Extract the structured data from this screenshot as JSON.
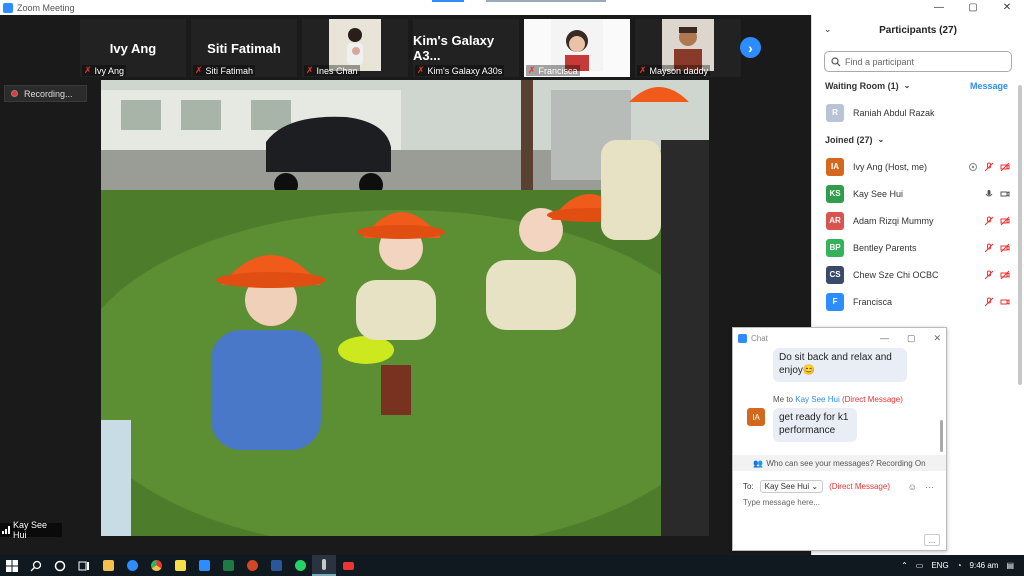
{
  "window": {
    "title": "Zoom Meeting",
    "controls": [
      "—",
      "▢",
      "✕"
    ]
  },
  "gallery": {
    "tiles": [
      {
        "big_name": "Ivy Ang",
        "label": "Ivy Ang",
        "has_video": false
      },
      {
        "big_name": "Siti Fatimah",
        "label": "Siti Fatimah",
        "has_video": false
      },
      {
        "big_name": "",
        "label": "Ines Chan",
        "has_video": true
      },
      {
        "big_name": "Kim's Galaxy A3...",
        "label": "Kim's Galaxy A30s",
        "has_video": false
      },
      {
        "big_name": "",
        "label": "Francisca",
        "has_video": true
      },
      {
        "big_name": "",
        "label": "Mayson daddy",
        "has_video": true
      }
    ],
    "next_icon": "chevron-right-icon"
  },
  "recording": {
    "label": "Recording..."
  },
  "active_speaker": {
    "name": "Kay See Hui"
  },
  "participants": {
    "title": "Participants (27)",
    "search_placeholder": "Find a participant",
    "waiting_room": {
      "label": "Waiting Room (1)",
      "message_button": "Message",
      "people": [
        {
          "initial": "R",
          "name": "Raniah Abdul Razak",
          "color": "#b8c4d6"
        }
      ]
    },
    "joined": {
      "label": "Joined (27)",
      "people": [
        {
          "initials": "IA",
          "name": "Ivy Ang (Host, me)",
          "color": "#d2691e",
          "mic": "muted",
          "video": "off",
          "extra": "share-icon"
        },
        {
          "initials": "KS",
          "name": "Kay See Hui",
          "color": "#2e9e4a",
          "mic": "on",
          "video": "on"
        },
        {
          "initials": "AR",
          "name": "Adam Rizqi Mummy",
          "color": "#d9534f",
          "mic": "muted",
          "video": "off"
        },
        {
          "initials": "BP",
          "name": "Bentley Parents",
          "color": "#34b35a",
          "mic": "muted",
          "video": "off"
        },
        {
          "initials": "CS",
          "name": "Chew Sze Chi OCBC",
          "color": "#3a4a6b",
          "mic": "muted",
          "video": "off"
        },
        {
          "initials": "F",
          "name": "Francisca",
          "color": "#2d8cff",
          "mic": "muted",
          "video": "on"
        }
      ]
    }
  },
  "chat": {
    "title": "Chat",
    "messages": [
      {
        "text": "Do sit back and relax and enjoy😊"
      },
      {
        "meta_from": "Me to",
        "meta_to": "Kay See Hui",
        "meta_dm": "(Direct Message)",
        "avatar": "IA",
        "text": "get ready for k1 performance"
      }
    ],
    "who_can_see": "Who can see your messages? Recording On",
    "to_label": "To:",
    "to_recipient": "Kay See Hui",
    "to_dm": "(Direct Message)",
    "input_placeholder": "Type message here...",
    "more_label": "..."
  },
  "taskbar": {
    "language": "ENG",
    "time": "9:46 am",
    "apps": [
      "windows-icon",
      "search-icon",
      "cortana-icon",
      "task-view-icon",
      "file-explorer-icon",
      "edge-icon",
      "chrome-icon",
      "sticky-notes-icon",
      "zoom-icon",
      "excel-icon",
      "powerpoint-icon",
      "word-icon",
      "whatsapp-icon",
      "app-icon",
      "youtube-icon"
    ]
  }
}
